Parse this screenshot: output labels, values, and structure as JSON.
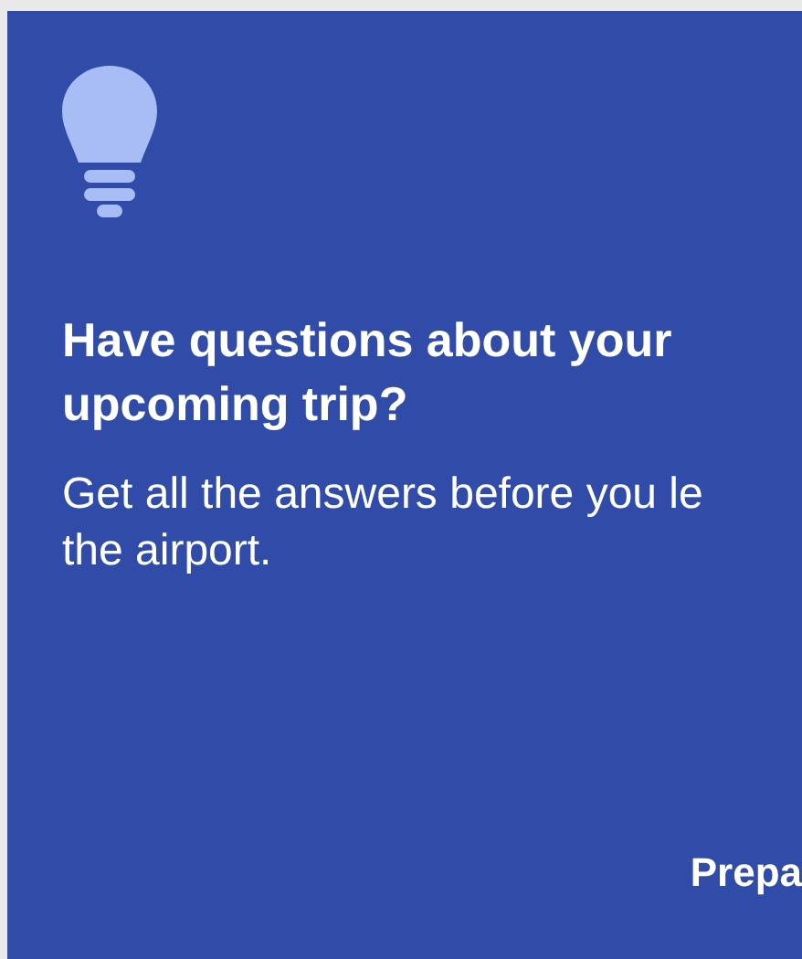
{
  "card": {
    "title_lines": [
      "Have questions about your",
      "upcoming trip?"
    ],
    "text_lines": [
      "Get all the answers before you le",
      "the airport."
    ],
    "action": "Prepa"
  }
}
